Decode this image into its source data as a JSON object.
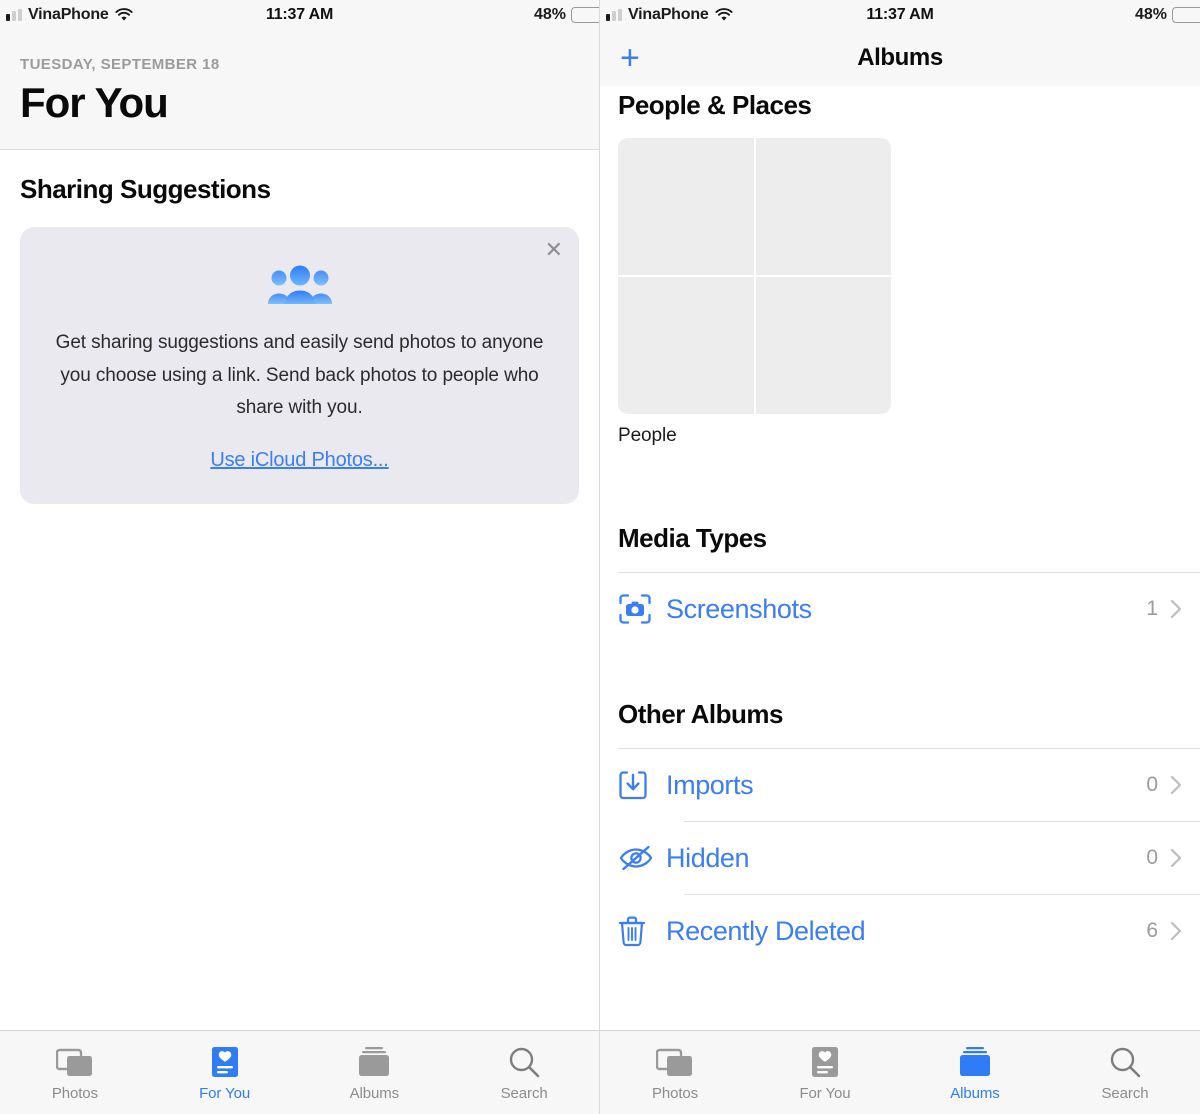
{
  "status_bar": {
    "carrier": "VinaPhone",
    "time": "11:37 AM",
    "battery_percent": "48%",
    "battery_level": 48,
    "signal_icon": "cellular-signal-icon",
    "wifi_icon": "wifi-icon",
    "battery_icon": "battery-icon",
    "battery_color": "#4cd562"
  },
  "left_panel": {
    "header": {
      "date": "TUESDAY, SEPTEMBER 18",
      "title": "For You"
    },
    "sharing": {
      "section_title": "Sharing Suggestions",
      "close_icon": "close-icon",
      "illustration_icon": "people-group-icon",
      "body": "Get sharing suggestions and easily send photos to anyone you choose using a link. Send back photos to people who share with you.",
      "link_label": "Use iCloud Photos...",
      "link_color": "#3b7ef4",
      "card_background": "#e9e9ef"
    },
    "tabs": [
      {
        "label": "Photos",
        "icon": "photos-stack-icon",
        "active": false
      },
      {
        "label": "For You",
        "icon": "for-you-card-icon",
        "active": true
      },
      {
        "label": "Albums",
        "icon": "albums-folder-icon",
        "active": false
      },
      {
        "label": "Search",
        "icon": "search-icon",
        "active": false
      }
    ]
  },
  "right_panel": {
    "navbar": {
      "add_icon": "plus-icon",
      "title": "Albums"
    },
    "people_places": {
      "section_title": "People & Places",
      "album_label": "People",
      "thumbnail_cells": 4
    },
    "media_types": {
      "section_title": "Media Types",
      "rows": [
        {
          "label": "Screenshots",
          "count": "1",
          "icon": "screenshot-camera-icon",
          "chevron": "chevron-right-icon"
        }
      ]
    },
    "other_albums": {
      "section_title": "Other Albums",
      "rows": [
        {
          "label": "Imports",
          "count": "0",
          "icon": "import-tray-icon",
          "chevron": "chevron-right-icon"
        },
        {
          "label": "Hidden",
          "count": "0",
          "icon": "eye-slash-icon",
          "chevron": "chevron-right-icon"
        },
        {
          "label": "Recently Deleted",
          "count": "6",
          "icon": "trash-icon",
          "chevron": "chevron-right-icon"
        }
      ]
    },
    "tabs": [
      {
        "label": "Photos",
        "icon": "photos-stack-icon",
        "active": false
      },
      {
        "label": "For You",
        "icon": "for-you-card-icon",
        "active": false
      },
      {
        "label": "Albums",
        "icon": "albums-folder-icon",
        "active": true
      },
      {
        "label": "Search",
        "icon": "search-icon",
        "active": false
      }
    ]
  },
  "theme": {
    "accent": "#3b7ef4",
    "tab_active": "#2f7cf6",
    "tab_inactive": "#8c8c8c",
    "separator": "#e0e0e0",
    "chrome_background": "#f7f7f7"
  }
}
